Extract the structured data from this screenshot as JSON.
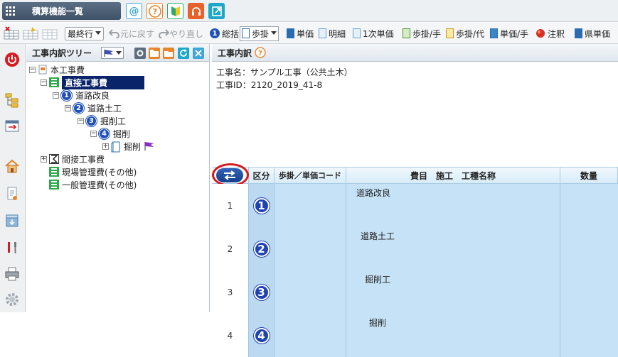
{
  "titlebar": {
    "app_label": "積算機能一覧",
    "quick_buttons": [
      {
        "icon": "at-icon",
        "glyph": "@",
        "color": "#3ea6d8"
      },
      {
        "icon": "help-icon",
        "glyph": "?",
        "color": "#e8842a"
      },
      {
        "icon": "beginner-icon",
        "glyph": "",
        "color": "#2ea86b"
      },
      {
        "icon": "support-icon",
        "glyph": "",
        "color": "#e8612a"
      },
      {
        "icon": "external-icon",
        "glyph": "",
        "color": "#1fa7c9"
      }
    ]
  },
  "toolbar": {
    "level_select": "最終行",
    "undo": "元に戻す",
    "redo": "やり直し",
    "summary": "総括",
    "step": "歩掛",
    "unit_price": "単価",
    "detail": "明細",
    "first_unit_price": "1次単価",
    "step_manual": "歩掛/手",
    "step_substitute": "歩掛/代",
    "unit_price_manual": "単価/手",
    "note": "注釈",
    "prefecture_unit_price": "県単価"
  },
  "tree": {
    "title": "工事内訳ツリー",
    "nodes": [
      {
        "label": "本工事費"
      },
      {
        "label": "直接工事費"
      },
      {
        "label": "道路改良",
        "num": "1"
      },
      {
        "label": "道路土工",
        "num": "2"
      },
      {
        "label": "掘削工",
        "num": "3"
      },
      {
        "label": "掘削",
        "num": "4"
      },
      {
        "label": "掘削"
      },
      {
        "label": "間接工事費"
      },
      {
        "label": "現場管理費(その他)"
      },
      {
        "label": "一般管理費(その他)"
      }
    ]
  },
  "detail": {
    "title": "工事内訳",
    "project_name": "工事名：サンプル工事（公共土木）",
    "project_id": "工事ID：2120_2019_41-8",
    "columns": {
      "category": "区分",
      "code": "歩掛／単価コード",
      "name": "費目　施工　工種名称",
      "qty": "数量"
    },
    "rows": [
      {
        "no": "1",
        "cat": "1",
        "name": "道路改良"
      },
      {
        "no": "2",
        "cat": "2",
        "name": "道路土工"
      },
      {
        "no": "3",
        "cat": "3",
        "name": "掘削工"
      },
      {
        "no": "4",
        "cat": "4",
        "name": "掘削"
      }
    ]
  },
  "colors": {
    "accent": "#1f4fb8",
    "selected": "#0a246a",
    "grid_blue": "#c6e2f6",
    "annotation_red": "#d71920"
  }
}
